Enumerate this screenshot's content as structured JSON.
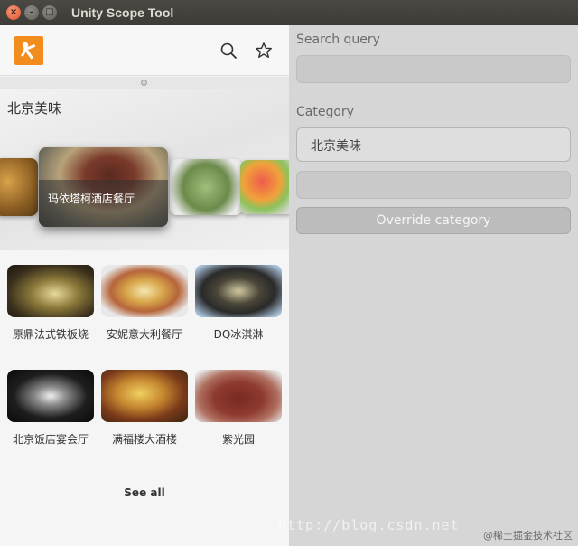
{
  "window": {
    "title": "Unity Scope Tool",
    "close_glyph": "×",
    "min_glyph": "–",
    "max_glyph": "□"
  },
  "header": {
    "logo_icon": "app-logo-icon",
    "search_icon": "search-icon",
    "favorite_icon": "star-icon",
    "logo_color": "#f18c1d"
  },
  "hero": {
    "section_title": "北京美味",
    "featured_caption": "玛依塔柯酒店餐厅"
  },
  "grid": {
    "items": [
      {
        "label": "原鼎法式铁板烧"
      },
      {
        "label": "安妮意大利餐厅"
      },
      {
        "label": "DQ冰淇淋"
      },
      {
        "label": "北京饭店宴会厅"
      },
      {
        "label": "满福楼大酒楼"
      },
      {
        "label": "紫光园"
      }
    ],
    "see_all": "See all"
  },
  "controls": {
    "search_label": "Search query",
    "search_value": "",
    "category_label": "Category",
    "category_value": "北京美味",
    "override_value": "",
    "override_button": "Override category"
  },
  "watermark": {
    "url": "http://blog.csdn.net",
    "credit": "@稀土掘金技术社区"
  }
}
